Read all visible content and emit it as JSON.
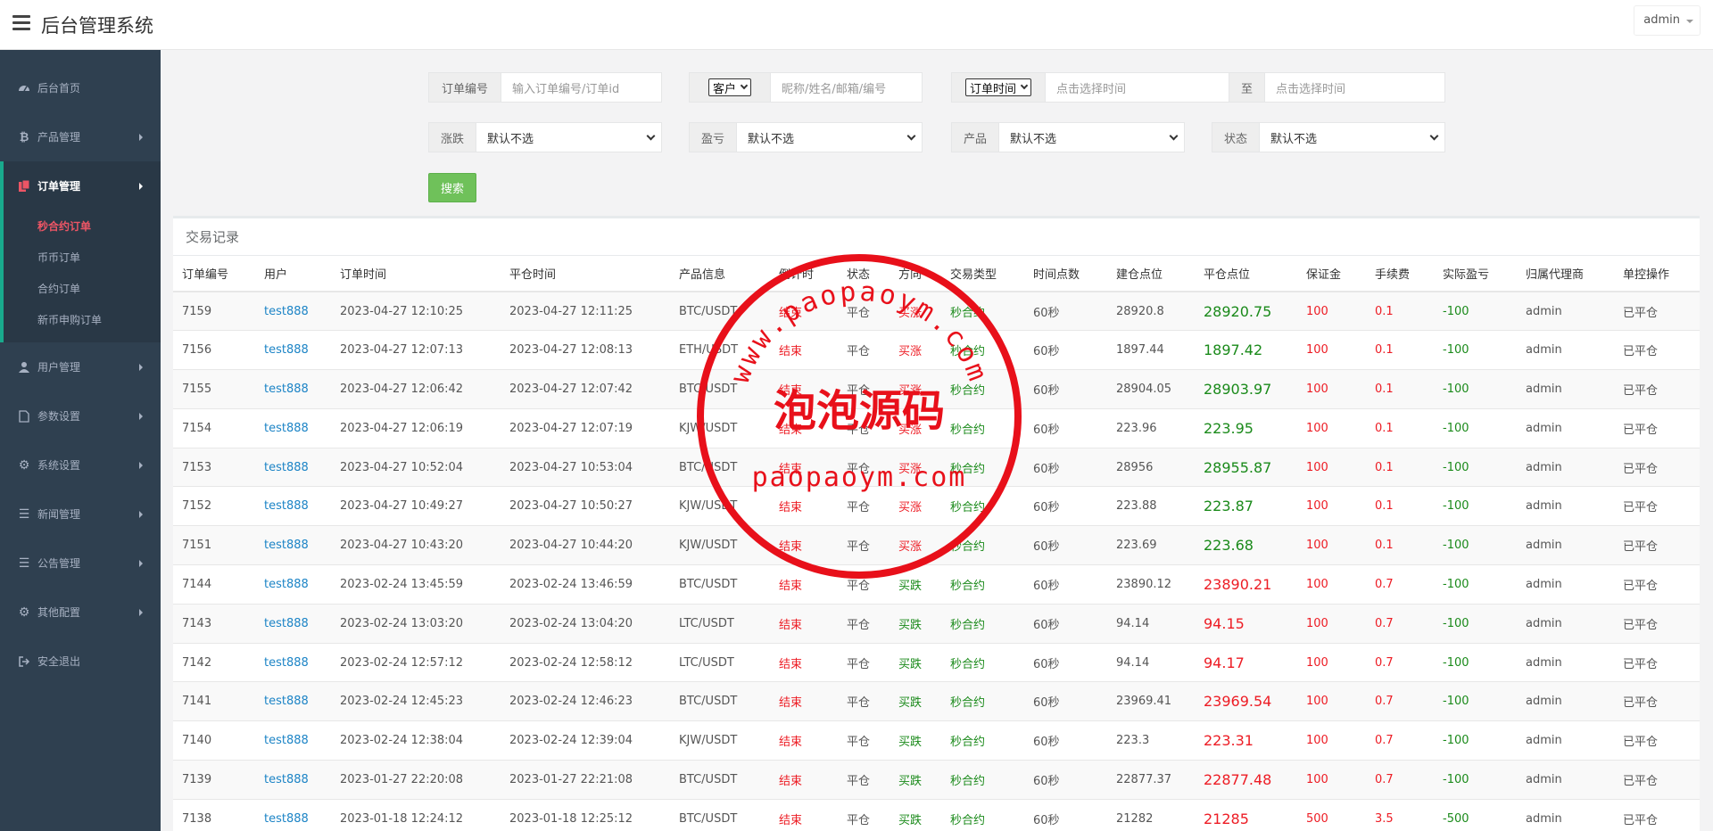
{
  "header": {
    "title": "后台管理系统",
    "user": "admin"
  },
  "sidebar": {
    "items": [
      {
        "label": "后台首页",
        "icon": "dashboard-icon"
      },
      {
        "label": "产品管理",
        "icon": "bitcoin-icon"
      },
      {
        "label": "订单管理",
        "icon": "orders-icon"
      },
      {
        "label": "用户管理",
        "icon": "user-icon"
      },
      {
        "label": "参数设置",
        "icon": "file-icon"
      },
      {
        "label": "系统设置",
        "icon": "gears-icon"
      },
      {
        "label": "新闻管理",
        "icon": "list-icon"
      },
      {
        "label": "公告管理",
        "icon": "list-icon"
      },
      {
        "label": "其他配置",
        "icon": "gear-icon"
      },
      {
        "label": "安全退出",
        "icon": "logout-icon"
      }
    ],
    "sub_items": [
      "秒合约订单",
      "币币订单",
      "合约订单",
      "新币申购订单"
    ]
  },
  "filters": {
    "order_no_label": "订单编号",
    "order_no_placeholder": "输入订单编号/订单id",
    "customer_select": "客户",
    "customer_placeholder": "昵称/姓名/邮箱/编号",
    "time_select": "订单时间",
    "time_start_placeholder": "点击选择时间",
    "to_label": "至",
    "time_end_placeholder": "点击选择时间",
    "rise_fall_label": "涨跌",
    "rise_fall_value": "默认不选",
    "profit_label": "盈亏",
    "profit_value": "默认不选",
    "product_label": "产品",
    "product_value": "默认不选",
    "status_label": "状态",
    "status_value": "默认不选",
    "search_button": "搜索"
  },
  "table": {
    "title": "交易记录",
    "columns": [
      "订单编号",
      "用户",
      "订单时间",
      "平仓时间",
      "产品信息",
      "倒计时",
      "状态",
      "方向",
      "交易类型",
      "时间点数",
      "建仓点位",
      "平仓点位",
      "保证金",
      "手续费",
      "实际盈亏",
      "归属代理商",
      "单控操作"
    ],
    "rows": [
      {
        "id": "7159",
        "user": "test888",
        "order_time": "2023-04-27 12:10:25",
        "close_time": "2023-04-27 12:11:25",
        "product": "BTC/USDT",
        "countdown": "结束",
        "status": "平仓",
        "direction": "买涨",
        "type": "秒合约",
        "period": "60秒",
        "open": "28920.8",
        "close": "28920.75",
        "margin": "100",
        "fee": "0.1",
        "pnl": "-100",
        "agent": "admin",
        "control": "已平仓"
      },
      {
        "id": "7156",
        "user": "test888",
        "order_time": "2023-04-27 12:07:13",
        "close_time": "2023-04-27 12:08:13",
        "product": "ETH/USDT",
        "countdown": "结束",
        "status": "平仓",
        "direction": "买涨",
        "type": "秒合约",
        "period": "60秒",
        "open": "1897.44",
        "close": "1897.42",
        "margin": "100",
        "fee": "0.1",
        "pnl": "-100",
        "agent": "admin",
        "control": "已平仓"
      },
      {
        "id": "7155",
        "user": "test888",
        "order_time": "2023-04-27 12:06:42",
        "close_time": "2023-04-27 12:07:42",
        "product": "BTC/USDT",
        "countdown": "结束",
        "status": "平仓",
        "direction": "买涨",
        "type": "秒合约",
        "period": "60秒",
        "open": "28904.05",
        "close": "28903.97",
        "margin": "100",
        "fee": "0.1",
        "pnl": "-100",
        "agent": "admin",
        "control": "已平仓"
      },
      {
        "id": "7154",
        "user": "test888",
        "order_time": "2023-04-27 12:06:19",
        "close_time": "2023-04-27 12:07:19",
        "product": "KJW/USDT",
        "countdown": "结束",
        "status": "平仓",
        "direction": "买涨",
        "type": "秒合约",
        "period": "60秒",
        "open": "223.96",
        "close": "223.95",
        "margin": "100",
        "fee": "0.1",
        "pnl": "-100",
        "agent": "admin",
        "control": "已平仓"
      },
      {
        "id": "7153",
        "user": "test888",
        "order_time": "2023-04-27 10:52:04",
        "close_time": "2023-04-27 10:53:04",
        "product": "BTC/USDT",
        "countdown": "结束",
        "status": "平仓",
        "direction": "买涨",
        "type": "秒合约",
        "period": "60秒",
        "open": "28956",
        "close": "28955.87",
        "margin": "100",
        "fee": "0.1",
        "pnl": "-100",
        "agent": "admin",
        "control": "已平仓"
      },
      {
        "id": "7152",
        "user": "test888",
        "order_time": "2023-04-27 10:49:27",
        "close_time": "2023-04-27 10:50:27",
        "product": "KJW/USDT",
        "countdown": "结束",
        "status": "平仓",
        "direction": "买涨",
        "type": "秒合约",
        "period": "60秒",
        "open": "223.88",
        "close": "223.87",
        "margin": "100",
        "fee": "0.1",
        "pnl": "-100",
        "agent": "admin",
        "control": "已平仓"
      },
      {
        "id": "7151",
        "user": "test888",
        "order_time": "2023-04-27 10:43:20",
        "close_time": "2023-04-27 10:44:20",
        "product": "KJW/USDT",
        "countdown": "结束",
        "status": "平仓",
        "direction": "买涨",
        "type": "秒合约",
        "period": "60秒",
        "open": "223.69",
        "close": "223.68",
        "margin": "100",
        "fee": "0.1",
        "pnl": "-100",
        "agent": "admin",
        "control": "已平仓"
      },
      {
        "id": "7144",
        "user": "test888",
        "order_time": "2023-02-24 13:45:59",
        "close_time": "2023-02-24 13:46:59",
        "product": "BTC/USDT",
        "countdown": "结束",
        "status": "平仓",
        "direction": "买跌",
        "type": "秒合约",
        "period": "60秒",
        "open": "23890.12",
        "close": "23890.21",
        "margin": "100",
        "fee": "0.7",
        "pnl": "-100",
        "agent": "admin",
        "control": "已平仓"
      },
      {
        "id": "7143",
        "user": "test888",
        "order_time": "2023-02-24 13:03:20",
        "close_time": "2023-02-24 13:04:20",
        "product": "LTC/USDT",
        "countdown": "结束",
        "status": "平仓",
        "direction": "买跌",
        "type": "秒合约",
        "period": "60秒",
        "open": "94.14",
        "close": "94.15",
        "margin": "100",
        "fee": "0.7",
        "pnl": "-100",
        "agent": "admin",
        "control": "已平仓"
      },
      {
        "id": "7142",
        "user": "test888",
        "order_time": "2023-02-24 12:57:12",
        "close_time": "2023-02-24 12:58:12",
        "product": "LTC/USDT",
        "countdown": "结束",
        "status": "平仓",
        "direction": "买跌",
        "type": "秒合约",
        "period": "60秒",
        "open": "94.14",
        "close": "94.17",
        "margin": "100",
        "fee": "0.7",
        "pnl": "-100",
        "agent": "admin",
        "control": "已平仓"
      },
      {
        "id": "7141",
        "user": "test888",
        "order_time": "2023-02-24 12:45:23",
        "close_time": "2023-02-24 12:46:23",
        "product": "BTC/USDT",
        "countdown": "结束",
        "status": "平仓",
        "direction": "买跌",
        "type": "秒合约",
        "period": "60秒",
        "open": "23969.41",
        "close": "23969.54",
        "margin": "100",
        "fee": "0.7",
        "pnl": "-100",
        "agent": "admin",
        "control": "已平仓"
      },
      {
        "id": "7140",
        "user": "test888",
        "order_time": "2023-02-24 12:38:04",
        "close_time": "2023-02-24 12:39:04",
        "product": "KJW/USDT",
        "countdown": "结束",
        "status": "平仓",
        "direction": "买跌",
        "type": "秒合约",
        "period": "60秒",
        "open": "223.3",
        "close": "223.31",
        "margin": "100",
        "fee": "0.7",
        "pnl": "-100",
        "agent": "admin",
        "control": "已平仓"
      },
      {
        "id": "7139",
        "user": "test888",
        "order_time": "2023-01-27 22:20:08",
        "close_time": "2023-01-27 22:21:08",
        "product": "BTC/USDT",
        "countdown": "结束",
        "status": "平仓",
        "direction": "买跌",
        "type": "秒合约",
        "period": "60秒",
        "open": "22877.37",
        "close": "22877.48",
        "margin": "100",
        "fee": "0.7",
        "pnl": "-100",
        "agent": "admin",
        "control": "已平仓"
      },
      {
        "id": "7138",
        "user": "test888",
        "order_time": "2023-01-18 12:24:12",
        "close_time": "2023-01-18 12:25:12",
        "product": "BTC/USDT",
        "countdown": "结束",
        "status": "平仓",
        "direction": "买跌",
        "type": "秒合约",
        "period": "60秒",
        "open": "21282",
        "close": "21285",
        "margin": "500",
        "fee": "3.5",
        "pnl": "-500",
        "agent": "admin",
        "control": "已平仓"
      }
    ]
  },
  "watermark": {
    "top_text": "www.paopaoym.com",
    "center_text": "泡泡源码",
    "bottom_text": "paopaoym.com"
  },
  "colors": {
    "sidebar_bg": "#2f4050",
    "accent_red": "#ed5565",
    "link_blue": "#1c84c6",
    "green": "#1a8a1a",
    "red": "#ed1c24",
    "search_green": "#6fc15a"
  }
}
